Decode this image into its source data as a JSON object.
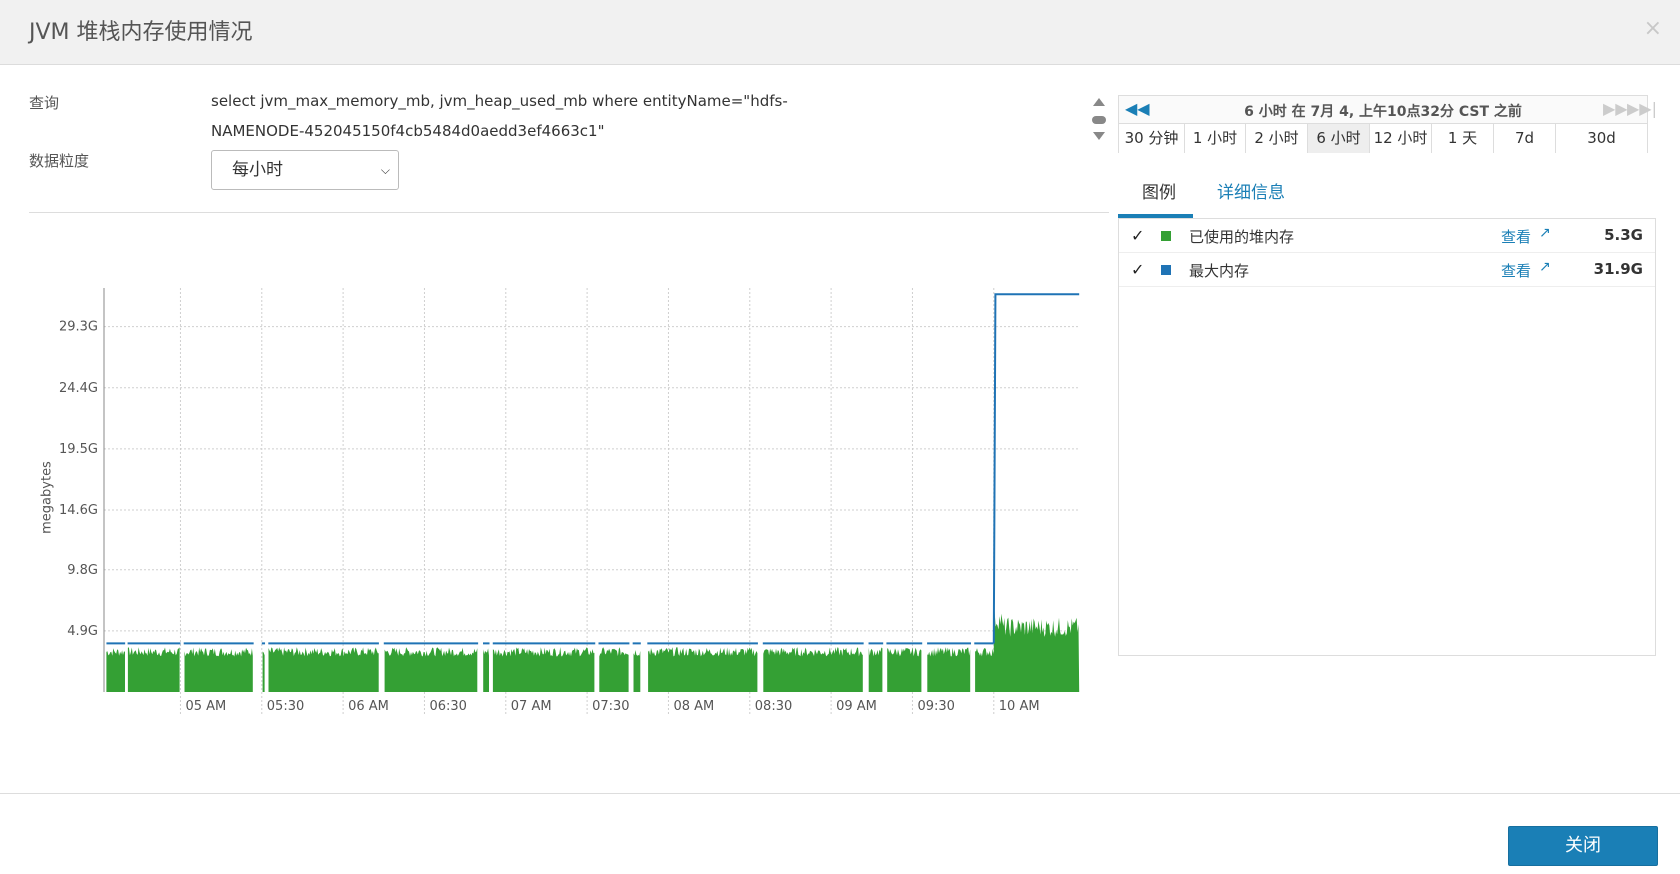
{
  "modal": {
    "title": "JVM 堆栈内存使用情况",
    "close_icon": "×"
  },
  "form": {
    "query_label": "查询",
    "query_text": "select jvm_max_memory_mb, jvm_heap_used_mb where entityName=\"hdfs-NAMENODE-452045150f4cb5484d0aedd3ef4663c1\"",
    "granularity_label": "数据粒度",
    "granularity_value": "每小时"
  },
  "time_nav": {
    "title": "6 小时 在 7月 4, 上午10点32分 CST 之前",
    "ranges": [
      "30 分钟",
      "1 小时",
      "2 小时",
      "6 小时",
      "12 小时",
      "1 天",
      "7d",
      "30d"
    ],
    "active_range": "6 小时"
  },
  "tabs": {
    "legend": "图例",
    "details": "详细信息"
  },
  "legend": {
    "items": [
      {
        "check": "✓",
        "name": "已使用的堆内存",
        "view": "查看",
        "value": "5.3G",
        "color": "#34a034"
      },
      {
        "check": "✓",
        "name": "最大内存",
        "view": "查看",
        "value": "31.9G",
        "color": "#1f73b5"
      }
    ]
  },
  "footer": {
    "close_label": "关闭"
  },
  "chart_data": {
    "type": "area",
    "ylabel": "megabytes",
    "yticks": [
      "4.9G",
      "9.8G",
      "14.6G",
      "19.5G",
      "24.4G",
      "29.3G"
    ],
    "ytick_values": [
      4.9,
      9.8,
      14.6,
      19.5,
      24.4,
      29.3
    ],
    "ylim": [
      0,
      32.4
    ],
    "xticks": [
      "05 AM",
      "05:30",
      "06 AM",
      "06:30",
      "07 AM",
      "07:30",
      "08 AM",
      "08:30",
      "09 AM",
      "09:30",
      "10 AM"
    ],
    "xtick_values": [
      5.0,
      5.5,
      6.0,
      6.5,
      7.0,
      7.5,
      8.0,
      8.5,
      9.0,
      9.5,
      10.0
    ],
    "xlim": [
      4.53,
      10.53
    ],
    "grid": true,
    "series": [
      {
        "name": "最大内存",
        "color": "#1f73b5",
        "step_x": 10.0,
        "values_before": 3.9,
        "values_after": 31.9
      },
      {
        "name": "已使用的堆内存",
        "color": "#34a034",
        "base": 3.2,
        "after_step": 5.3,
        "gaps": [
          [
            4.66,
            4.675
          ],
          [
            5.0,
            5.02
          ],
          [
            5.45,
            5.5
          ],
          [
            5.52,
            5.54
          ],
          [
            6.22,
            6.25
          ],
          [
            6.83,
            6.86
          ],
          [
            6.9,
            6.92
          ],
          [
            7.55,
            7.57
          ],
          [
            7.76,
            7.78
          ],
          [
            7.83,
            7.87
          ],
          [
            8.55,
            8.58
          ],
          [
            9.2,
            9.23
          ],
          [
            9.32,
            9.34
          ],
          [
            9.56,
            9.59
          ],
          [
            9.86,
            9.88
          ]
        ]
      }
    ]
  }
}
